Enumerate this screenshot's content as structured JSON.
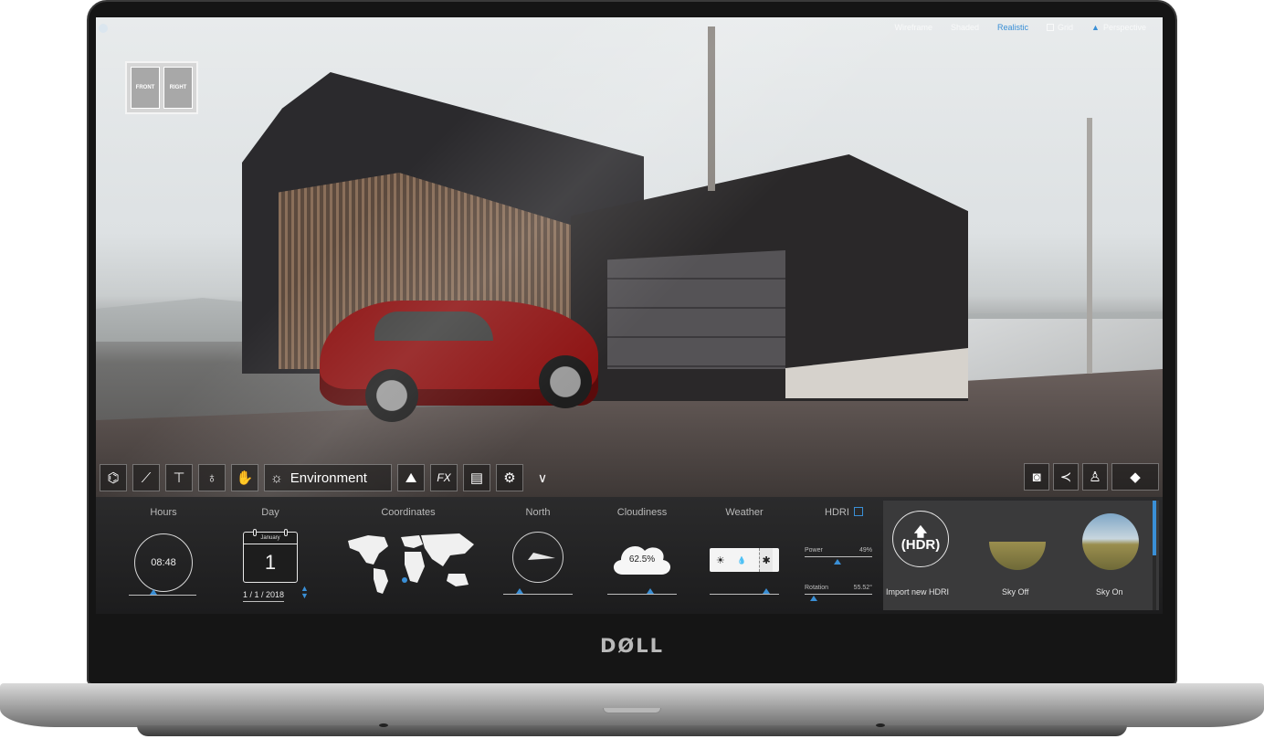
{
  "view_modes": {
    "items": [
      "Wireframe",
      "Shaded",
      "Realistic",
      "Grid",
      "Perspective"
    ],
    "active": "Realistic"
  },
  "nav_cube": {
    "left_face": "FRONT",
    "right_face": "RIGHT"
  },
  "toolbar": {
    "active_label": "Environment",
    "icons": [
      "project-tree-icon",
      "furniture-icon",
      "paint-roller-icon",
      "light-bulb-icon",
      "hand-icon",
      "weather-icon",
      "landscape-icon",
      "fx-icon",
      "clapper-icon",
      "gear-icon",
      "chevron-down-icon"
    ]
  },
  "right_toolbar": {
    "icons": [
      "camera-icon",
      "share-icon",
      "person-icon",
      "vr-headset-icon"
    ]
  },
  "environment_panel": {
    "hours": {
      "label": "Hours",
      "value": "08:48"
    },
    "day": {
      "label": "Day",
      "month": "January",
      "day_number": "1",
      "date": "1 / 1 / 2018"
    },
    "coordinates": {
      "label": "Coordinates"
    },
    "north": {
      "label": "North"
    },
    "cloudiness": {
      "label": "Cloudiness",
      "value": "62.5%"
    },
    "weather": {
      "label": "Weather",
      "options": [
        "☀",
        "💧",
        "✱"
      ]
    },
    "hdri": {
      "label": "HDRI",
      "power_label": "Power",
      "power_value": "49%",
      "rotation_label": "Rotation",
      "rotation_value": "55.52°"
    },
    "gallery": {
      "import_label": "Import new HDRI",
      "import_badge": "(HDR)",
      "items": [
        {
          "label": "Sky Off"
        },
        {
          "label": "Sky On"
        }
      ]
    }
  },
  "brand": {
    "logo_text": "DØLL"
  }
}
